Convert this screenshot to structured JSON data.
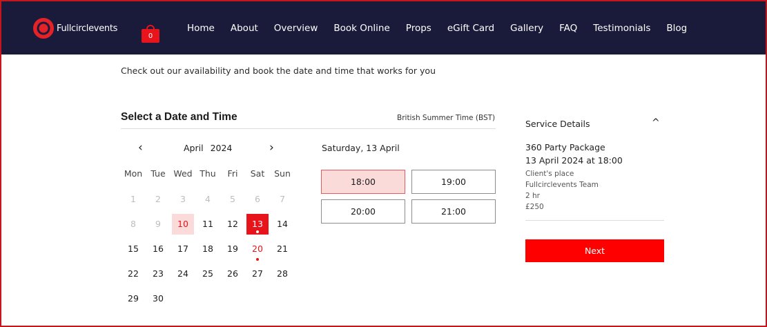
{
  "header": {
    "logo_text": "Fullcirclevents",
    "cart_count": "0",
    "nav": [
      "Home",
      "About",
      "Overview",
      "Book Online",
      "Props",
      "eGift Card",
      "Gallery",
      "FAQ",
      "Testimonials",
      "Blog"
    ]
  },
  "intro": "Check out our availability and book the date and time that works for you",
  "booking": {
    "title": "Select a Date and Time",
    "timezone": "British Summer Time (BST)",
    "calendar": {
      "prev": "‹",
      "next": "›",
      "month": "April",
      "year": "2024",
      "weekdays": [
        "Mon",
        "Tue",
        "Wed",
        "Thu",
        "Fri",
        "Sat",
        "Sun"
      ],
      "days": [
        [
          "1",
          "2",
          "3",
          "4",
          "5",
          "6",
          "7"
        ],
        [
          "8",
          "9",
          "10",
          "11",
          "12",
          "13",
          "14"
        ],
        [
          "15",
          "16",
          "17",
          "18",
          "19",
          "20",
          "21"
        ],
        [
          "22",
          "23",
          "24",
          "25",
          "26",
          "27",
          "28"
        ],
        [
          "29",
          "30"
        ]
      ]
    },
    "selected_date_label": "Saturday, 13 April",
    "slots": [
      "18:00",
      "19:00",
      "20:00",
      "21:00"
    ],
    "selected_slot": "18:00"
  },
  "service_details": {
    "title": "Service Details",
    "toggle_icon": "^",
    "service": "360 Party Package",
    "datetime": "13 April 2024 at 18:00",
    "location": "Client's place",
    "staff": "Fullcirclevents Team",
    "duration": "2 hr",
    "price": "£250",
    "next_label": "Next"
  },
  "colors": {
    "header_bg": "#1a1b3a",
    "accent": "#e8141b",
    "selected_bg": "#fbdada"
  }
}
